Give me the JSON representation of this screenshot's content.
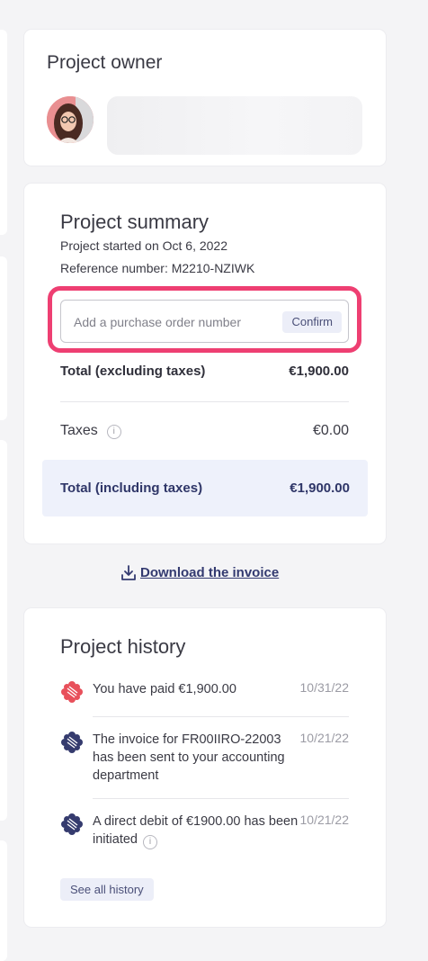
{
  "owner": {
    "title": "Project owner"
  },
  "summary": {
    "title": "Project summary",
    "started": "Project started on Oct 6, 2022",
    "reference": "Reference number: M2210-NZIWK",
    "po_placeholder": "Add a purchase order number",
    "confirm_label": "Confirm",
    "excl_label": "Total (excluding taxes)",
    "excl_value": "€1,900.00",
    "taxes_label": "Taxes",
    "taxes_value": "€0.00",
    "incl_label": "Total (including taxes)",
    "incl_value": "€1,900.00"
  },
  "download": {
    "label": "Download the invoice"
  },
  "history": {
    "title": "Project history",
    "items": [
      {
        "text": "You have paid €1,900.00",
        "date": "10/31/22",
        "logo_color": "#e8505b"
      },
      {
        "text": "The invoice for FR00IIRO-22003 has been sent to your accounting department",
        "date": "10/21/22",
        "logo_color": "#353b6e"
      },
      {
        "text": "A direct debit of €1900.00 has been initiated",
        "date": "10/21/22",
        "logo_color": "#353b6e"
      }
    ],
    "see_all": "See all history"
  },
  "colors": {
    "accent": "#333a70",
    "highlight": "#ee3f72",
    "total_bg": "#eef1fb"
  }
}
